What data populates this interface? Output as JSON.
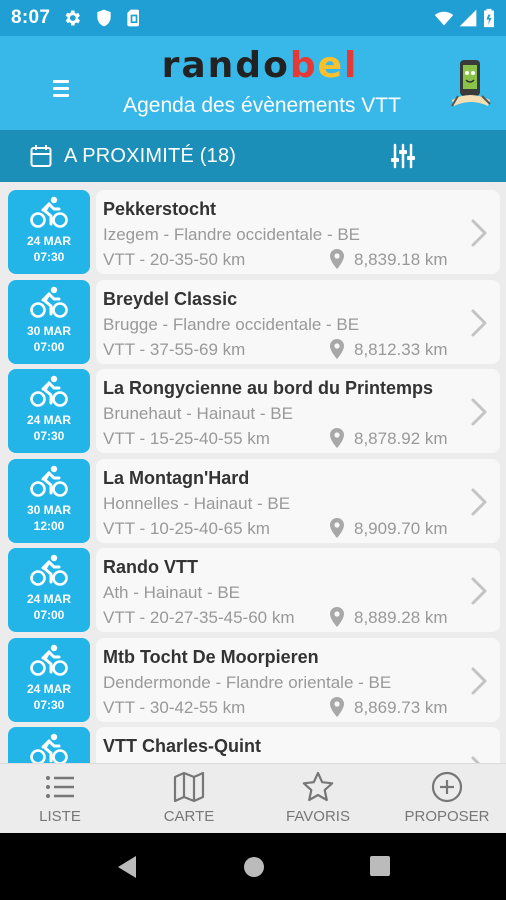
{
  "status_bar": {
    "time": "8:07",
    "left_icons": [
      "gear-icon",
      "shield-icon",
      "sim-card-icon"
    ],
    "right_icons": [
      "wifi-icon",
      "signal-icon",
      "battery-icon"
    ]
  },
  "app_bar": {
    "logo_text": "randobel",
    "subtitle": "Agenda des évènements VTT"
  },
  "filter_bar": {
    "label": "A PROXIMITÉ (18)"
  },
  "events": [
    {
      "date": "24 MAR",
      "time": "07:30",
      "title": "Pekkerstocht",
      "location": "Izegem - Flandre occidentale - BE",
      "distances": "VTT - 20-35-50 km",
      "distance_away": "8,839.18 km"
    },
    {
      "date": "30 MAR",
      "time": "07:00",
      "title": "Breydel Classic",
      "location": "Brugge - Flandre occidentale - BE",
      "distances": "VTT - 37-55-69 km",
      "distance_away": "8,812.33 km"
    },
    {
      "date": "24 MAR",
      "time": "07:30",
      "title": "La Rongycienne au bord du Printemps",
      "location": "Brunehaut - Hainaut - BE",
      "distances": "VTT - 15-25-40-55 km",
      "distance_away": "8,878.92 km"
    },
    {
      "date": "30 MAR",
      "time": "12:00",
      "title": "La Montagn'Hard",
      "location": "Honnelles - Hainaut - BE",
      "distances": "VTT - 10-25-40-65 km",
      "distance_away": "8,909.70 km"
    },
    {
      "date": "24 MAR",
      "time": "07:00",
      "title": "Rando VTT",
      "location": "Ath - Hainaut - BE",
      "distances": "VTT - 20-27-35-45-60 km",
      "distance_away": "8,889.28 km"
    },
    {
      "date": "24 MAR",
      "time": "07:30",
      "title": "Mtb Tocht De Moorpieren",
      "location": "Dendermonde - Flandre orientale - BE",
      "distances": "VTT - 30-42-55 km",
      "distance_away": "8,869.73 km"
    },
    {
      "date": "",
      "time": "",
      "title": "VTT Charles-Quint",
      "location": "",
      "distances": "",
      "distance_away": ""
    }
  ],
  "bottom_nav": [
    {
      "label": "LISTE",
      "icon": "list-icon"
    },
    {
      "label": "CARTE",
      "icon": "map-icon"
    },
    {
      "label": "FAVORIS",
      "icon": "star-icon"
    },
    {
      "label": "PROPOSER",
      "icon": "add-circle-icon"
    }
  ],
  "colors": {
    "status_bar": "#1f9fd3",
    "app_bar": "#37b8e8",
    "filter_bar": "#1b8fb8",
    "date_box": "#23b5e8",
    "card_bg": "#f8f8f8"
  }
}
